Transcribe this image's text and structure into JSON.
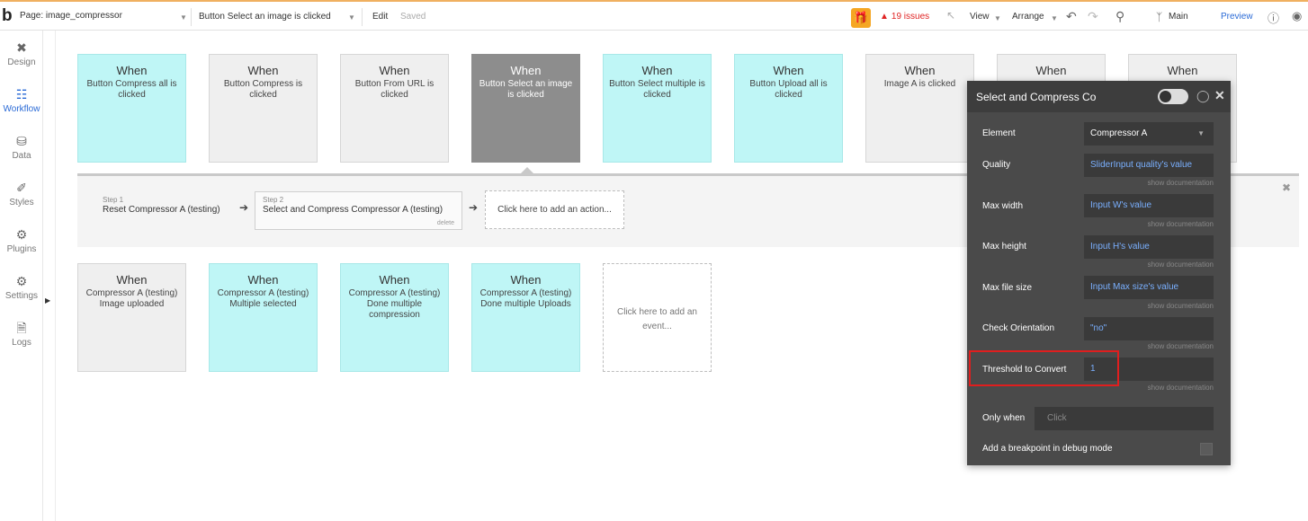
{
  "topbar": {
    "logo": "b",
    "page_selector": "Page: image_compressor",
    "event_selector": "Button Select an image is clicked",
    "edit": "Edit",
    "saved": "Saved",
    "issues": "19 issues",
    "view": "View",
    "arrange": "Arrange",
    "branch": "Main",
    "preview": "Preview"
  },
  "sidebar": {
    "items": [
      {
        "label": "Design",
        "icon": "design-icon"
      },
      {
        "label": "Workflow",
        "icon": "workflow-icon"
      },
      {
        "label": "Data",
        "icon": "data-icon"
      },
      {
        "label": "Styles",
        "icon": "styles-icon"
      },
      {
        "label": "Plugins",
        "icon": "plugins-icon"
      },
      {
        "label": "Settings",
        "icon": "settings-icon"
      },
      {
        "label": "Logs",
        "icon": "logs-icon"
      }
    ]
  },
  "events_row1": [
    {
      "when": "When",
      "desc": "Button Compress all is clicked"
    },
    {
      "when": "When",
      "desc": "Button Compress is clicked"
    },
    {
      "when": "When",
      "desc": "Button From URL is clicked"
    },
    {
      "when": "When",
      "desc": "Button Select an image is clicked"
    },
    {
      "when": "When",
      "desc": "Button Select multiple is clicked"
    },
    {
      "when": "When",
      "desc": "Button Upload all is clicked"
    },
    {
      "when": "When",
      "desc": "Image A is clicked"
    },
    {
      "when": "When",
      "desc": ""
    },
    {
      "when": "When",
      "desc": ""
    }
  ],
  "events_row2": [
    {
      "when": "When",
      "desc": "Compressor A (testing) Image uploaded"
    },
    {
      "when": "When",
      "desc": "Compressor A (testing) Multiple selected"
    },
    {
      "when": "When",
      "desc": "Compressor A (testing) Done multiple compression"
    },
    {
      "when": "When",
      "desc": "Compressor A (testing) Done multiple Uploads"
    },
    {
      "when": "",
      "desc": "Click here to add an event..."
    }
  ],
  "actions": {
    "step1_num": "Step 1",
    "step1_text": "Reset Compressor A (testing)",
    "step2_num": "Step 2",
    "step2_text": "Select and Compress Compressor A (testing)",
    "step2_delete": "delete",
    "add_action": "Click here to add an action..."
  },
  "panel": {
    "title": "Select and Compress Co",
    "show_doc": "show documentation",
    "element_label": "Element",
    "element_value": "Compressor A",
    "quality_label": "Quality",
    "quality_value": "SliderInput quality's value",
    "maxwidth_label": "Max width",
    "maxwidth_value": "Input W's value",
    "maxheight_label": "Max height",
    "maxheight_value": "Input H's value",
    "maxsize_label": "Max file size",
    "maxsize_value": "Input Max size's value",
    "orient_label": "Check Orientation",
    "orient_value": "\"no\"",
    "threshold_label": "Threshold to Convert",
    "threshold_value": "1",
    "onlywhen_label": "Only when",
    "onlywhen_placeholder": "Click",
    "breakpoint_label": "Add a breakpoint in debug mode"
  },
  "colors": {
    "cyan_card": "#bff6f6",
    "gray_card": "#efefef",
    "selected_card": "#8d8d8d",
    "panel_bg": "#4a4a4a",
    "accent_blue": "#2a6ad6",
    "issues_red": "#e02424",
    "highlight_red": "#e01e1e"
  }
}
